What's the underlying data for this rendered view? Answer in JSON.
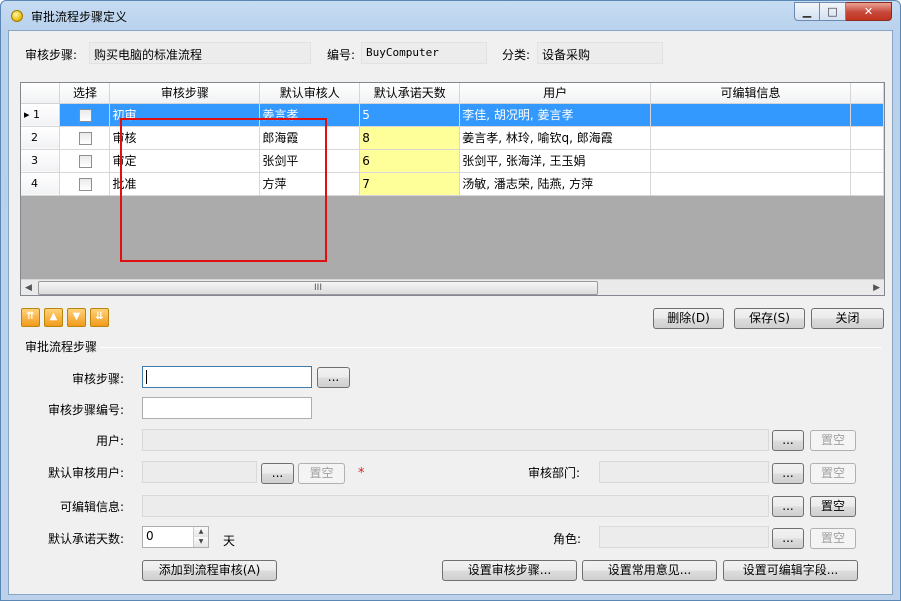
{
  "window": {
    "title": "审批流程步骤定义",
    "min": "▁",
    "max": "□",
    "close": "✕"
  },
  "header": {
    "step_label": "审核步骤:",
    "step_value": "购买电脑的标准流程",
    "code_label": "编号:",
    "code_value": "BuyComputer",
    "category_label": "分类:",
    "category_value": "设备采购"
  },
  "grid": {
    "columns": [
      "选择",
      "审核步骤",
      "默认审核人",
      "默认承诺天数",
      "用户",
      "可编辑信息"
    ],
    "rows": [
      {
        "no": "1",
        "step": "初审",
        "reviewer": "姜言孝",
        "days": "5",
        "users": "李佳, 胡况明, 姜言孝",
        "editable": ""
      },
      {
        "no": "2",
        "step": "审核",
        "reviewer": "郎海霞",
        "days": "8",
        "users": "姜言孝, 林玲, 喻钦q, 郎海霞",
        "editable": ""
      },
      {
        "no": "3",
        "step": "审定",
        "reviewer": "张剑平",
        "days": "6",
        "users": "张剑平, 张海洋, 王玉娟",
        "editable": ""
      },
      {
        "no": "4",
        "step": "批准",
        "reviewer": "方萍",
        "days": "7",
        "users": "汤敏, 潘志荣, 陆燕, 方萍",
        "editable": ""
      }
    ],
    "selected_row": 0,
    "scroll_mark": "III"
  },
  "actions": {
    "delete": "删除(D)",
    "save": "保存(S)",
    "close": "关闭"
  },
  "form": {
    "section": "审批流程步骤",
    "step_label": "审核步骤:",
    "step_value": "",
    "step_code_label": "审核步骤编号:",
    "step_code_value": "",
    "user_label": "用户:",
    "default_user_label": "默认审核用户:",
    "dept_label": "审核部门:",
    "editable_label": "可编辑信息:",
    "days_label": "默认承诺天数:",
    "days_value": "0",
    "days_unit": "天",
    "role_label": "角色:",
    "browse": "...",
    "clear": "置空",
    "required_mark": "*"
  },
  "bottom": {
    "add": "添加到流程审核(A)",
    "set_steps": "设置审核步骤...",
    "set_opinions": "设置常用意见...",
    "set_fields": "设置可编辑字段..."
  }
}
